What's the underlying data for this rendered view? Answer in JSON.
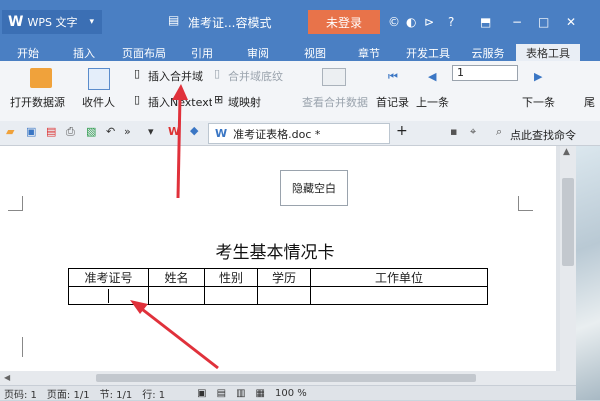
{
  "titlebar": {
    "app_name": "WPS 文字",
    "doc_title": "准考证...容模式",
    "login_label": "未登录",
    "window_icons": [
      "?",
      "−",
      "□",
      "✕"
    ]
  },
  "tabs": [
    "开始",
    "插入",
    "页面布局",
    "引用",
    "审阅",
    "视图",
    "章节",
    "开发工具",
    "云服务",
    "表格工具"
  ],
  "ribbon": {
    "open_datasource": "打开数据源",
    "recipients": "收件人",
    "insert_merge_field": "插入合并域",
    "merge_field_shading": "合并域底纹",
    "insert_next_field": "插入Nextext域",
    "field_mapping": "域映射",
    "view_merged_data": "查看合并数据",
    "first_record": "首记录",
    "prev_record": "上一条",
    "record_number": "1",
    "next_record": "下一条",
    "last_record": "尾"
  },
  "doc_tab": {
    "filename": "准考证表格.doc *",
    "search_label": "点此查找命令"
  },
  "document": {
    "hide_blank_button": "隐藏空白",
    "card_title": "考生基本情况卡",
    "table_headers": [
      "准考证号",
      "姓名",
      "性别",
      "学历",
      "工作单位"
    ]
  },
  "statusbar": {
    "page_num": "页码: 1",
    "pages": "页面: 1/1",
    "section": "节: 1/1",
    "line": "行: 1",
    "zoom": "100 %"
  },
  "colors": {
    "titlebar": "#4a7fc3",
    "login_button": "#e8734a",
    "annotation_arrow": "#e0313b"
  }
}
